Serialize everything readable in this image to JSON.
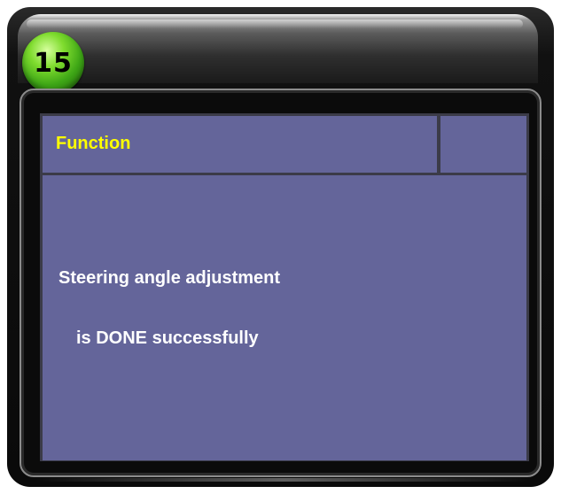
{
  "badge": {
    "number": "15",
    "color": "#4bb81e"
  },
  "header": {
    "title": "Function",
    "title_color": "#ffff00"
  },
  "message": {
    "line1": "Steering angle adjustment",
    "line2": "is DONE successfully"
  },
  "colors": {
    "panel": "#64659a",
    "frame": "#0b0b0b"
  }
}
